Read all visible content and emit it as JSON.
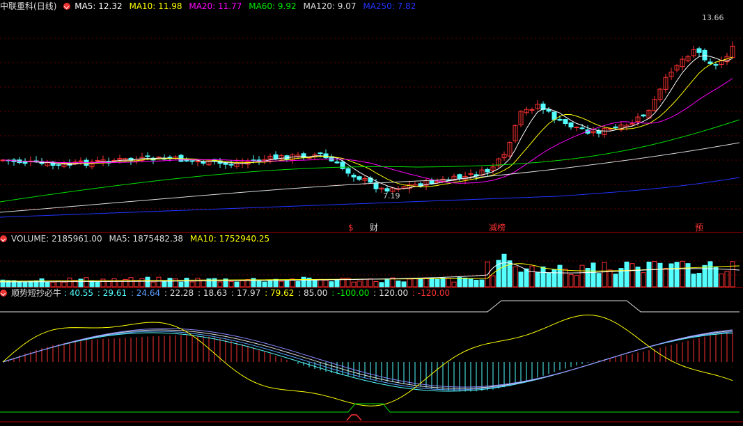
{
  "colors": {
    "bg": "#000000",
    "up": "#ff3232",
    "down": "#54ffff",
    "ma5": "#ffffff",
    "ma10": "#ffff00",
    "ma20": "#ff00ff",
    "ma60": "#00e000",
    "ma120": "#dddddd",
    "ma250": "#2233ff",
    "grid": "#8b0000"
  },
  "price_panel": {
    "stock_name": "中联重科",
    "period": "(日线)",
    "ma5": "MA5: 12.32",
    "ma10": "MA10: 11.98",
    "ma20": "MA20: 11.77",
    "ma60": "MA60: 9.92",
    "ma120": "MA120: 9.07",
    "ma250": "MA250: 7.82",
    "high_label": "13.66",
    "low_label": "7.19",
    "event_tags": [
      {
        "text": "$",
        "color": "#ff3232"
      },
      {
        "text": "财",
        "color": "#dddddd"
      },
      {
        "text": "减榜",
        "color": "#ff3232"
      },
      {
        "text": "预",
        "color": "#ff3232"
      }
    ]
  },
  "volume_panel": {
    "title": "VOLUME: 2185961.00",
    "ma5": "MA5: 1875482.38",
    "ma10": "MA10: 1752940.25"
  },
  "indicator_panel": {
    "name": "顺势短抄必牛",
    "values": [
      {
        "text": ": 40.55",
        "color": "#54ffff"
      },
      {
        "text": ": 29.61",
        "color": "#54ffff"
      },
      {
        "text": ": 24.64",
        "color": "#5aa0ff"
      },
      {
        "text": ": 22.28",
        "color": "#dddddd"
      },
      {
        "text": ": 18.63",
        "color": "#dddddd"
      },
      {
        "text": ": 17.97",
        "color": "#dddddd"
      },
      {
        "text": ": 79.62",
        "color": "#ffff00"
      },
      {
        "text": ": 85.00",
        "color": "#dddddd"
      },
      {
        "text": ": -100.00",
        "color": "#00e000"
      },
      {
        "text": ": 120.00",
        "color": "#dddddd"
      },
      {
        "text": ": -120.00",
        "color": "#ff3232"
      }
    ]
  },
  "icons": [
    "dropdown-icon"
  ]
}
